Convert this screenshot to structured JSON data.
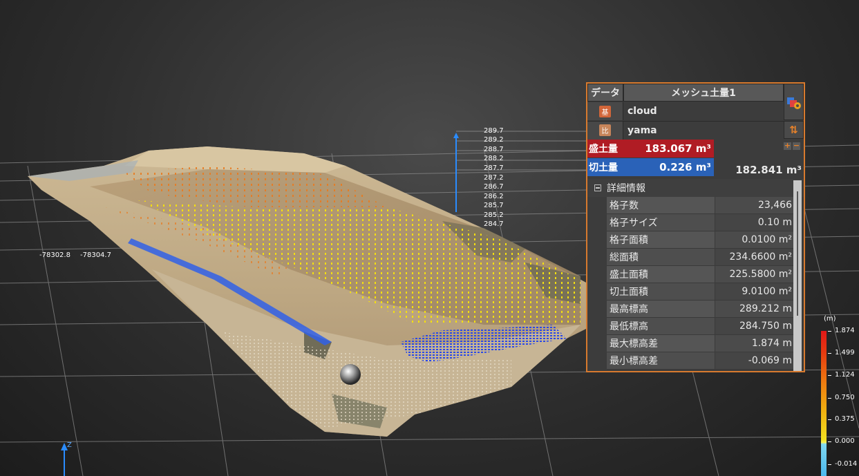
{
  "viewport": {
    "ruler_labels": [
      "289.7",
      "289.2",
      "288.7",
      "288.2",
      "287.7",
      "287.2",
      "286.7",
      "286.2",
      "285.7",
      "285.2",
      "284.7"
    ],
    "coord_labels": [
      "-78302.8",
      "-78304.7"
    ],
    "axis_label": "Z"
  },
  "panel": {
    "data_label": "データ",
    "title": "メッシュ土量1",
    "base_badge": "基",
    "base_value": "cloud",
    "compare_badge": "比",
    "compare_value": "yama",
    "fill_label": "盛土量",
    "fill_value": "183.067 m³",
    "cut_label": "切土量",
    "cut_value": "0.226 m³",
    "net_value": "182.841 m³",
    "details_title": "詳細情報",
    "details": [
      {
        "key": "格子数",
        "value": "23,466"
      },
      {
        "key": "格子サイズ",
        "value": "0.10 m"
      },
      {
        "key": "格子面積",
        "value": "0.0100 m²"
      },
      {
        "key": "総面積",
        "value": "234.6600 m²"
      },
      {
        "key": "盛土面積",
        "value": "225.5800 m²"
      },
      {
        "key": "切土面積",
        "value": "9.0100 m²"
      },
      {
        "key": "最高標高",
        "value": "289.212 m"
      },
      {
        "key": "最低標高",
        "value": "284.750 m"
      },
      {
        "key": "最大標高差",
        "value": "1.874 m"
      },
      {
        "key": "最小標高差",
        "value": "-0.069 m"
      }
    ]
  },
  "legend": {
    "unit": "(m)",
    "ticks": [
      "1.874",
      "1.499",
      "1.124",
      "0.750",
      "0.375",
      "0.000",
      "-0.014"
    ]
  },
  "colors": {
    "panel_border": "#d87a2e",
    "fill_red": "#b01c24",
    "cut_blue": "#2a62b8",
    "fill_points": "#f0e010",
    "cut_points": "#2040e0"
  }
}
